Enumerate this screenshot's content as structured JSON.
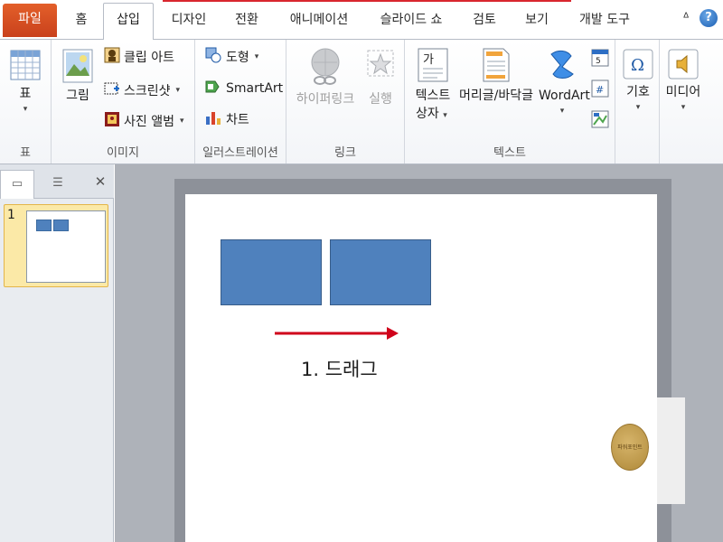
{
  "tabs": {
    "file": "파일",
    "home": "홈",
    "insert": "삽입",
    "design": "디자인",
    "transitions": "전환",
    "animations": "애니메이션",
    "slideshow": "슬라이드 쇼",
    "review": "검토",
    "view": "보기",
    "developer": "개발 도구"
  },
  "ribbon": {
    "table_group": {
      "table_label": "표",
      "group_label": "표"
    },
    "images_group": {
      "picture_label": "그림",
      "clipart_label": "클립 아트",
      "screenshot_label": "스크린샷",
      "photoalbum_label": "사진 앨범",
      "group_label": "이미지"
    },
    "illustrations_group": {
      "shapes_label": "도형",
      "smartart_label": "SmartArt",
      "chart_label": "차트",
      "group_label": "일러스트레이션"
    },
    "links_group": {
      "hyperlink_label": "하이퍼링크",
      "action_label": "실행",
      "group_label": "링크"
    },
    "text_group": {
      "textbox_label_1": "텍스트",
      "textbox_label_2": "상자",
      "headerfooter_label": "머리글/바닥글",
      "wordart_label": "WordArt",
      "textbox_icon_glyph": "가",
      "group_label": "텍스트"
    },
    "symbols_group": {
      "symbol_label": "기호"
    },
    "media_group": {
      "media_label": "미디어"
    }
  },
  "slides_pane": {
    "slide_number": "1"
  },
  "slide": {
    "drag_label": "1. 드래그",
    "badge_text": "파워포인트"
  },
  "colors": {
    "file_tab": "#d9532a",
    "shape_fill": "#4f81bd",
    "shape_border": "#385d8a",
    "drag_arrow": "#d0021b",
    "thumbnail_highlight": "#fbe9a7"
  }
}
